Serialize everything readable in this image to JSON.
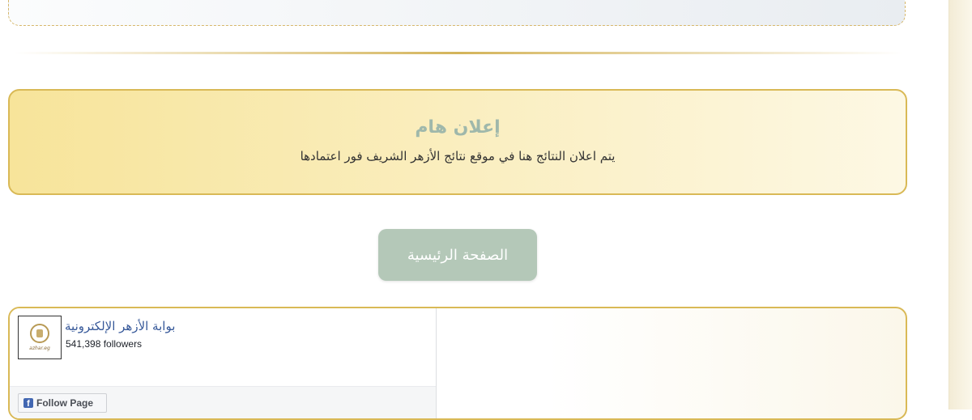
{
  "notice": {
    "title": "إعلان هام",
    "text": "يتم اعلان النتائج هنا في موقع نتائج الأزهر الشريف فور اعتمادها"
  },
  "home_button": {
    "label": "الصفحة الرئيسية"
  },
  "facebook": {
    "page_name": "بوابة الأزهر الإلكترونية",
    "followers": "541,398 followers",
    "logo_caption": "azhar.eg",
    "follow_label": "Follow Page",
    "icon_glyph": "f"
  },
  "colors": {
    "gold_border": "#d9b956",
    "notice_title": "#9fb8ab",
    "home_button_bg": "#b4c8b8",
    "fb_link": "#365899"
  }
}
